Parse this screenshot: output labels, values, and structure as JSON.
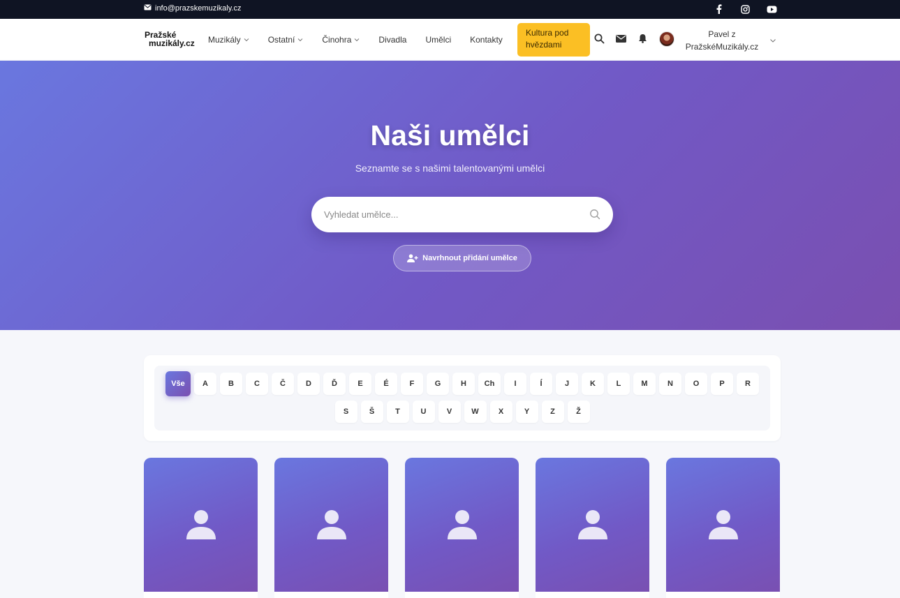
{
  "topbar": {
    "email": "info@prazskemuzikaly.cz",
    "social": [
      "facebook-icon",
      "instagram-icon",
      "youtube-icon"
    ]
  },
  "nav": {
    "logo_line1": "Pražské",
    "logo_line2": "muzikály.cz",
    "items": [
      {
        "label": "Muzikály",
        "dropdown": true
      },
      {
        "label": "Ostatní",
        "dropdown": true
      },
      {
        "label": "Činohra",
        "dropdown": true
      },
      {
        "label": "Divadla",
        "dropdown": false
      },
      {
        "label": "Umělci",
        "dropdown": false
      },
      {
        "label": "Kontakty",
        "dropdown": false
      }
    ],
    "cta_label": "Kultura pod hvězdami",
    "user_label": "Pavel z PražskéMuzikály.cz"
  },
  "hero": {
    "title": "Naši umělci",
    "subtitle": "Seznamte se s našimi talentovanými umělci",
    "search_placeholder": "Vyhledat umělce...",
    "suggest_label": "Navrhnout přidání umělce"
  },
  "alphabet": {
    "all_label": "Vše",
    "letters": [
      "A",
      "B",
      "C",
      "Č",
      "D",
      "Ď",
      "E",
      "É",
      "F",
      "G",
      "H",
      "Ch",
      "I",
      "Í",
      "J",
      "K",
      "L",
      "M",
      "N",
      "O",
      "P",
      "R",
      "S",
      "Š",
      "T",
      "U",
      "V",
      "W",
      "X",
      "Y",
      "Z",
      "Ž"
    ]
  },
  "colors": {
    "accent": "#7159c6",
    "cta": "#fbbf24",
    "topbar": "#0f1423"
  },
  "artist_cards_count": 5
}
